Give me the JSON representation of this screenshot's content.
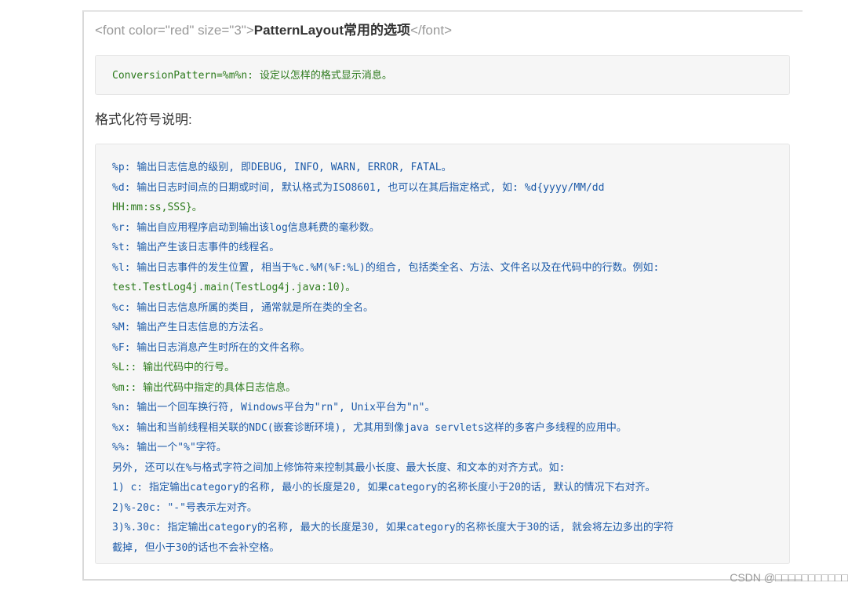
{
  "heading": {
    "open_tag": "<font color=\"red\" size=\"3\">",
    "title": "PatternLayout常用的选项",
    "close_tag": "</font>"
  },
  "conversion_box": {
    "text": "ConversionPattern=%m%n: 设定以怎样的格式显示消息。"
  },
  "format_heading": "格式化符号说明:",
  "format_lines": [
    "%p: 输出日志信息的级别, 即DEBUG, INFO, WARN, ERROR, FATAL。",
    "%d: 输出日志时间点的日期或时间, 默认格式为ISO8601, 也可以在其后指定格式, 如: %d{yyyy/MM/dd",
    "HH:mm:ss,SSS}。",
    "%r: 输出自应用程序启动到输出该log信息耗费的毫秒数。",
    "%t: 输出产生该日志事件的线程名。",
    "%l: 输出日志事件的发生位置, 相当于%c.%M(%F:%L)的组合, 包括类全名、方法、文件名以及在代码中的行数。例如:",
    "test.TestLog4j.main(TestLog4j.java:10)。",
    "%c: 输出日志信息所属的类目, 通常就是所在类的全名。",
    "%M: 输出产生日志信息的方法名。",
    "%F: 输出日志消息产生时所在的文件名称。",
    "%L:: 输出代码中的行号。",
    "%m:: 输出代码中指定的具体日志信息。",
    "%n: 输出一个回车换行符, Windows平台为\"rn\", Unix平台为\"n\"。",
    "%x: 输出和当前线程相关联的NDC(嵌套诊断环境), 尤其用到像java servlets这样的多客户多线程的应用中。",
    "%%: 输出一个\"%\"字符。",
    "另外, 还可以在%与格式字符之间加上修饰符来控制其最小长度、最大长度、和文本的对齐方式。如:",
    "1) c: 指定输出category的名称, 最小的长度是20, 如果category的名称长度小于20的话, 默认的情况下右对齐。",
    "2)%-20c: \"-\"号表示左对齐。",
    "3)%.30c: 指定输出category的名称, 最大的长度是30, 如果category的名称长度大于30的话, 就会将左边多出的字符",
    "截掉, 但小于30的话也不会补空格。"
  ],
  "line_colors": [
    "blue",
    "blue",
    "green",
    "blue",
    "blue",
    "blue",
    "green",
    "blue",
    "blue",
    "blue",
    "green",
    "green",
    "blue",
    "blue",
    "blue",
    "blue",
    "blue",
    "blue",
    "blue",
    "blue"
  ],
  "watermark": "CSDN @□□□□□□□□□□□"
}
